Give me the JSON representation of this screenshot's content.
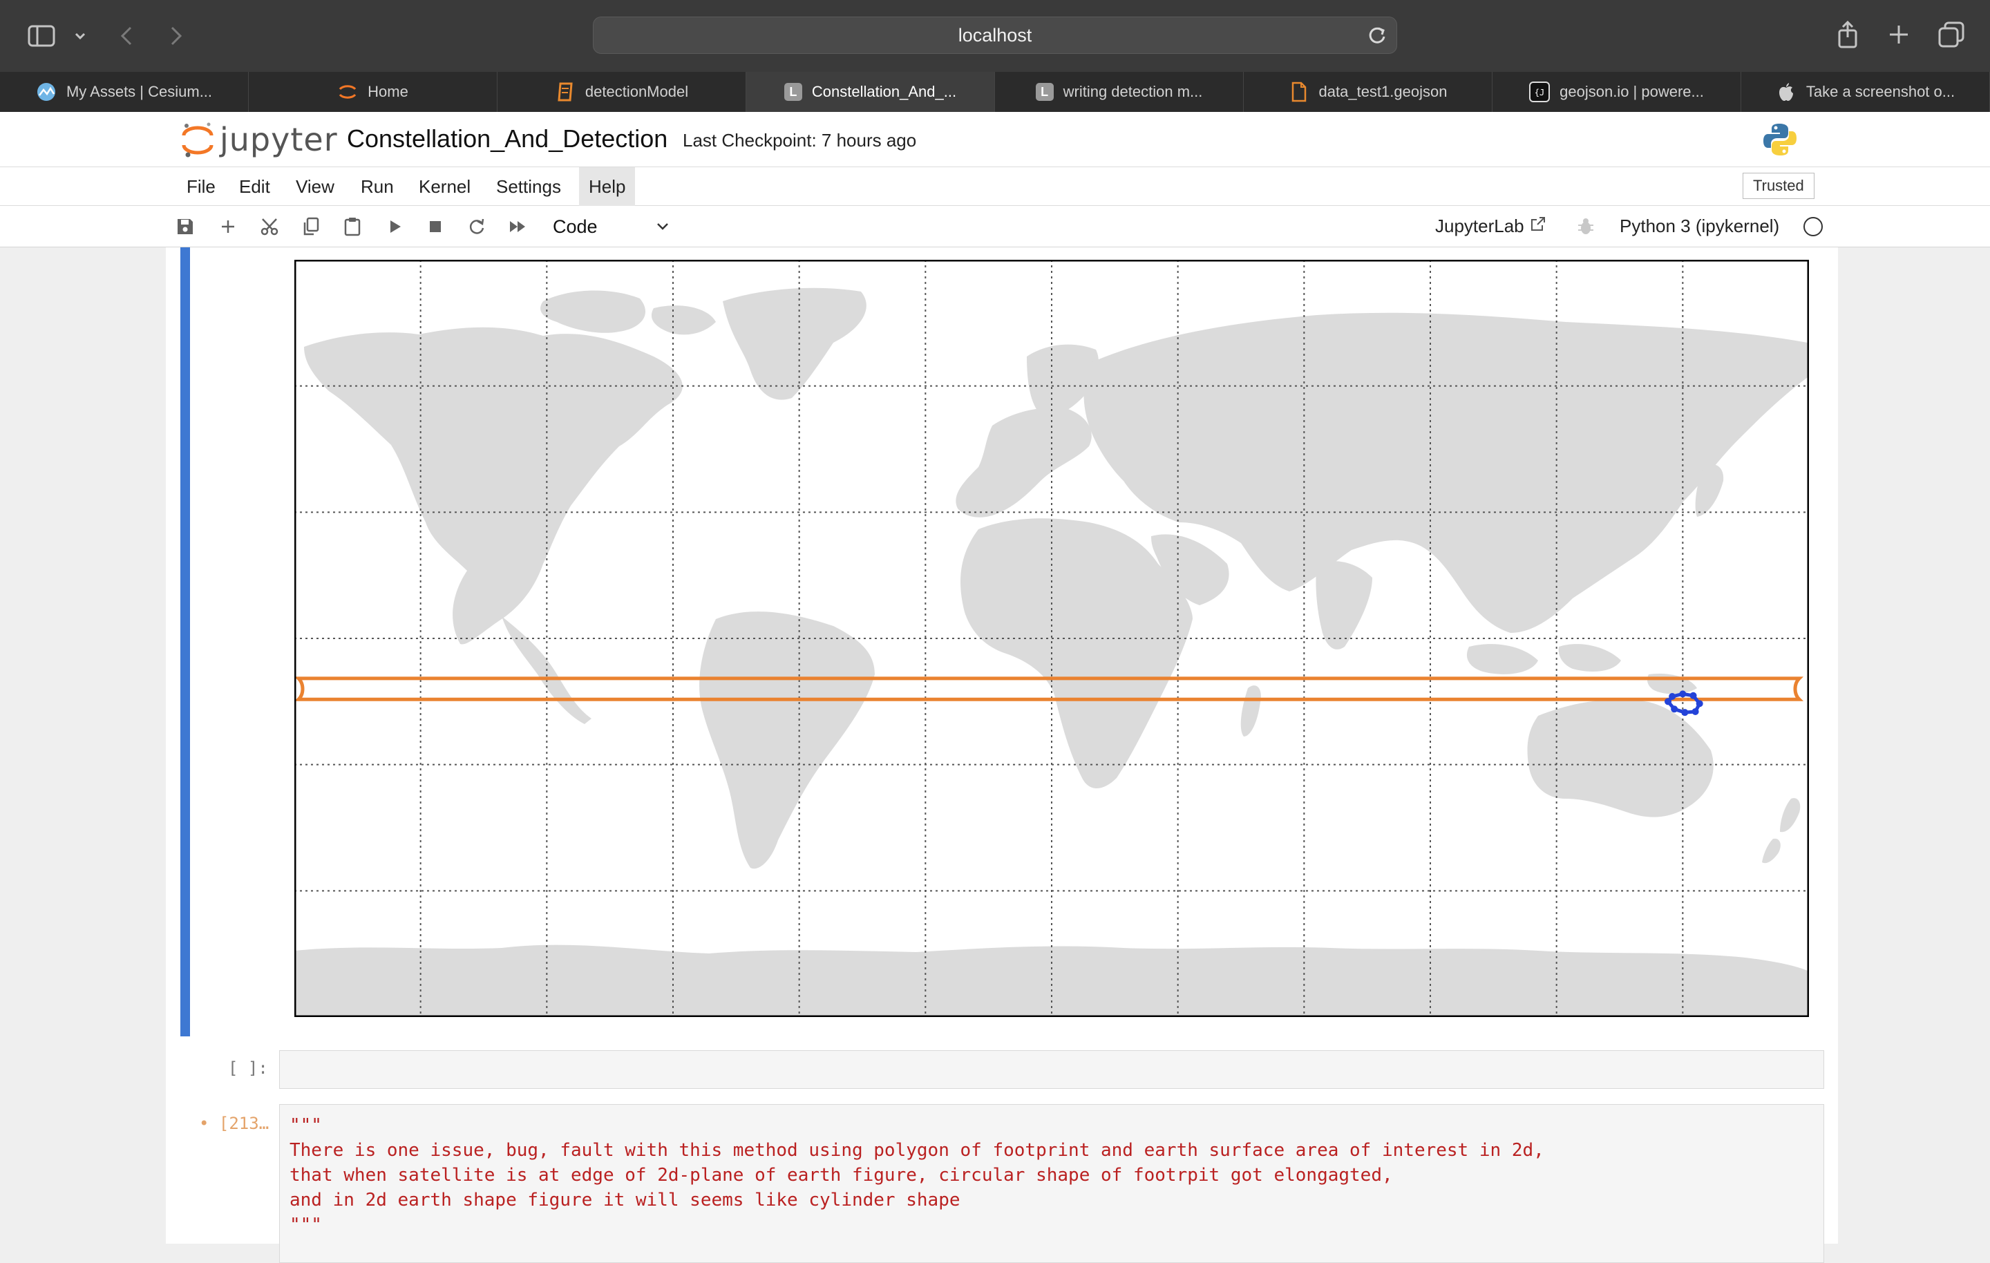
{
  "browser": {
    "url": "localhost",
    "tabs": [
      {
        "label": "My Assets | Cesium...",
        "icon": "cesium-icon",
        "active": false
      },
      {
        "label": "Home",
        "icon": "jupyter-icon",
        "active": false
      },
      {
        "label": "detectionModel",
        "icon": "notebook-icon",
        "active": false
      },
      {
        "label": "Constellation_And_...",
        "icon": "lab-icon",
        "active": true
      },
      {
        "label": "writing detection m...",
        "icon": "lab-icon",
        "active": false
      },
      {
        "label": "data_test1.geojson",
        "icon": "file-icon",
        "active": false
      },
      {
        "label": "geojson.io | powere...",
        "icon": "geojson-icon",
        "active": false
      },
      {
        "label": "Take a screenshot o...",
        "icon": "apple-icon",
        "active": false
      }
    ]
  },
  "jupyter": {
    "logo_text": "jupyter",
    "notebook_title": "Constellation_And_Detection",
    "checkpoint": "Last Checkpoint: 7 hours ago",
    "menu": [
      "File",
      "Edit",
      "View",
      "Run",
      "Kernel",
      "Settings",
      "Help"
    ],
    "active_menu": "Help",
    "trusted": "Trusted",
    "cell_type": "Code",
    "jupyterlab_link": "JupyterLab",
    "kernel": "Python 3 (ipykernel)"
  },
  "colors": {
    "land": "#dbdbdb",
    "grid": "#555555",
    "footprint_band": "#ea8230",
    "aoi_polygon": "#2443d8",
    "active_cell_bar": "#3e78d2",
    "code_string": "#ba2121"
  },
  "map": {
    "projection": "PlateCarree",
    "lon_range": [
      -180,
      180
    ],
    "lat_range": [
      -90,
      90
    ],
    "gridlines": true,
    "footprint_band": {
      "lat_top": -9.5,
      "lat_bottom": -14.5,
      "lon_range": [
        -180,
        180
      ]
    },
    "aoi_polygon": [
      [
        147.5,
        -13.8
      ],
      [
        150,
        -13.2
      ],
      [
        152.5,
        -13.6
      ],
      [
        154,
        -15.5
      ],
      [
        153,
        -17.4
      ],
      [
        150.5,
        -17.6
      ],
      [
        148,
        -16.8
      ],
      [
        146.5,
        -15
      ]
    ]
  },
  "cells": {
    "empty_prompt": "[ ]:",
    "code_prompt": "• [213…",
    "code_text": "\"\"\"\nThere is one issue, bug, fault with this method using polygon of footprint and earth surface area of interest in 2d,\nthat when satellite is at edge of 2d-plane of earth figure, circular shape of footrpit got elongagted,\nand in 2d earth shape figure it will seems like cylinder shape\n\"\"\""
  }
}
